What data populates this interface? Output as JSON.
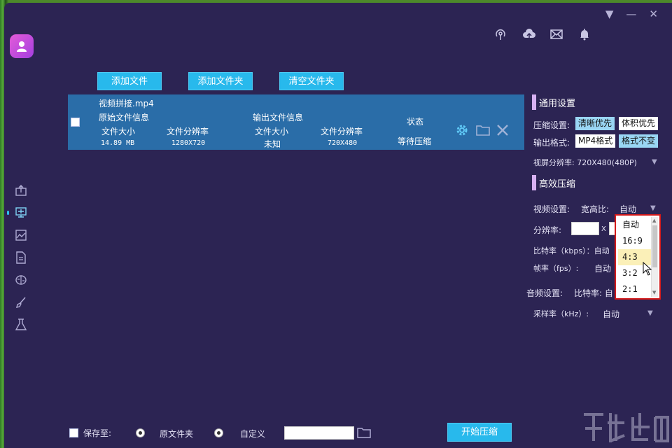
{
  "toolbar": {
    "add_file": "添加文件",
    "add_folder": "添加文件夹",
    "clear_folder": "清空文件夹"
  },
  "top_icons": [
    "broadcast-icon",
    "cloud-upload-icon",
    "mail-icon",
    "bell-icon"
  ],
  "side_nav": [
    "image-upload-icon",
    "video-compress-icon",
    "image-compress-icon",
    "pdf-compress-icon",
    "brain-icon",
    "brush-icon",
    "flask-icon"
  ],
  "file": {
    "name": "视频拼接.mp4",
    "original_info_label": "原始文件信息",
    "size_label": "文件大小",
    "size_value": "14.89 MB",
    "res_label": "文件分辨率",
    "res_value": "1280X720",
    "output_info_label": "输出文件信息",
    "out_size_label": "文件大小",
    "out_size_value": "未知",
    "out_res_label": "文件分辨率",
    "out_res_value": "720X480",
    "status_label": "状态",
    "status_value": "等待压缩"
  },
  "settings": {
    "general_title": "通用设置",
    "compress_label": "压缩设置:",
    "compress_opt1": "清晰优先",
    "compress_opt2": "体积优先",
    "format_label": "输出格式:",
    "format_opt1": "MP4格式",
    "format_opt2": "格式不变",
    "screen_res": "视屏分辨率: 720X480(480P)",
    "efficient_title": "高效压缩",
    "video_label": "视频设置:",
    "aspect_label": "宽高比:",
    "aspect_value": "自动",
    "resolution_label": "分辨率:",
    "resolution_x": "X",
    "bitrate_label": "比特率（kbps）：自动",
    "framerate_label": "帧率（fps）:",
    "framerate_value": "自动",
    "audio_label": "音频设置:",
    "audio_bitrate": "比特率: 自",
    "samplerate_label": "采样率（kHz）:",
    "samplerate_value": "自动"
  },
  "aspect_dropdown": {
    "options": [
      "自动",
      "16:9",
      "4:3",
      "3:2",
      "2:1"
    ],
    "highlighted": "4:3"
  },
  "bottom": {
    "save_to": "保存至:",
    "option_original": "原文件夹",
    "option_custom": "自定义",
    "path_value": "",
    "start_button": "开始压缩"
  },
  "colors": {
    "window_bg": "#2c2453",
    "accent": "#28b9ec",
    "file_row": "#2a6da8",
    "highlight": "#d41a1a"
  }
}
